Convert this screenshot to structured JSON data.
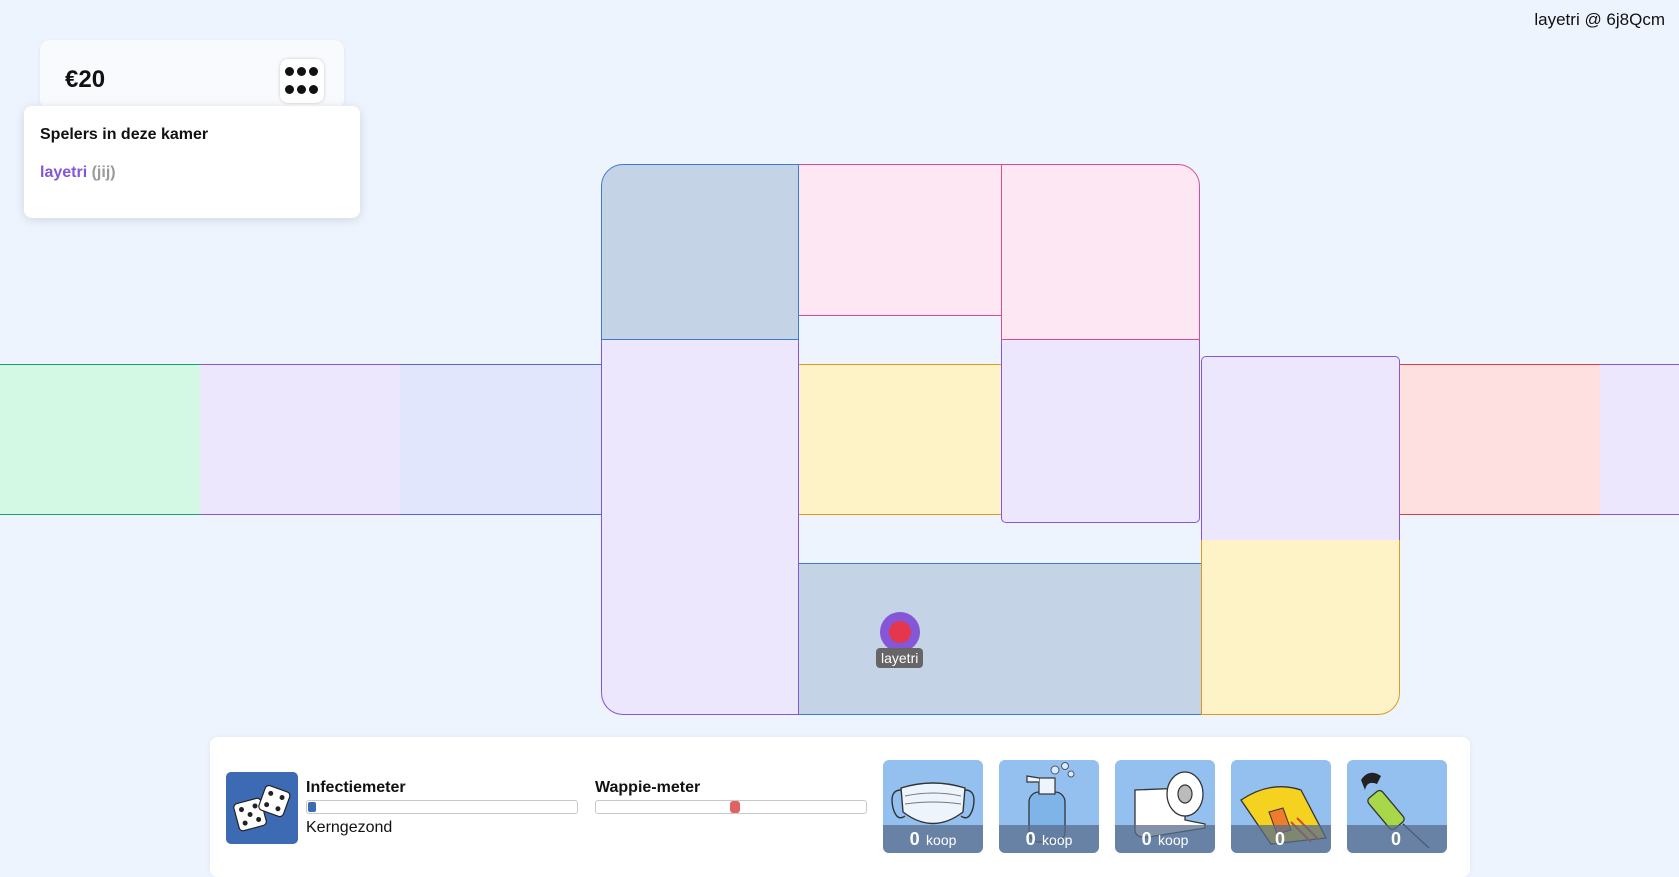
{
  "header": {
    "user_room": "layetri @ 6j8Qcm"
  },
  "money": {
    "amount": "€20"
  },
  "players": {
    "title": "Spelers in deze kamer",
    "list": [
      {
        "name": "layetri",
        "you_suffix": "(jij)"
      }
    ]
  },
  "board": {
    "token_player": "layetri",
    "colors": {
      "green": "#d3f8e4",
      "purple": "#ede7fd",
      "indigo": "#e2e6fd",
      "slate": "#c5d3e6",
      "pink": "#fde7f3",
      "yellow": "#fef3c7",
      "red": "#fee0e1"
    }
  },
  "bottom": {
    "infection_label": "Infectiemeter",
    "infection_value": 0.03,
    "infection_status": "Kerngezond",
    "wappie_label": "Wappie-meter",
    "wappie_value": 0.52,
    "items": [
      {
        "icon": "mask-icon",
        "count": "0",
        "action": "koop"
      },
      {
        "icon": "hand-sanitizer-icon",
        "count": "0",
        "action": "koop"
      },
      {
        "icon": "toilet-paper-icon",
        "count": "0",
        "action": "koop"
      },
      {
        "icon": "test-strip-icon",
        "count": "0",
        "action": ""
      },
      {
        "icon": "vaccine-icon",
        "count": "0",
        "action": ""
      }
    ]
  }
}
